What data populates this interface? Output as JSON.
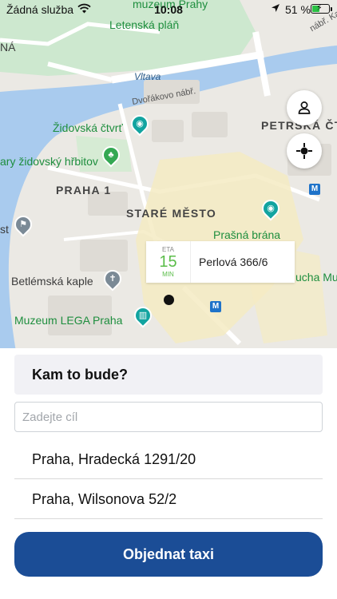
{
  "status_bar": {
    "carrier": "Žádná služba",
    "time": "10:08",
    "battery_percent": "51 %",
    "battery_level": 0.51
  },
  "map": {
    "labels": {
      "muzeum_prahy": "muzeum Prahy",
      "letenska_plan": "Letenská pláň",
      "na": "NÁ",
      "vltava": "Vltava",
      "dvorakovo": "Dvořákovo nábř.",
      "nabr": "nábř. Kap",
      "zidovska_ctvrt": "Židovská čtvrť",
      "petrska": "PETRSKÁ ČTVRŤ",
      "hrbitov": "ary židovský hřbitov",
      "praha1": "PRAHA 1",
      "stare_mesto": "STARÉ MĚSTO",
      "prasna_brana": "Prašná brána",
      "st": "st",
      "betlemska": "Betlémská kaple",
      "cha_mu": "ucha Mu",
      "lego": "Muzeum LEGA Praha"
    },
    "metro_label": "M"
  },
  "eta": {
    "caption": "ETA",
    "value": "15",
    "unit": "MIN",
    "address": "Perlová 366/6"
  },
  "sheet": {
    "header": "Kam to bude?",
    "input_placeholder": "Zadejte cíl",
    "input_value": "",
    "suggestions": [
      "Praha, Hradecká 1291/20",
      "Praha, Wilsonova 52/2"
    ],
    "order_button": "Objednat taxi"
  },
  "colors": {
    "accent": "#1b4d96",
    "eta_green": "#5bbd4a",
    "water": "#a9cbee",
    "park": "#c8e6c9"
  },
  "icons": {
    "profile": "person-icon",
    "locate": "crosshair-icon"
  }
}
